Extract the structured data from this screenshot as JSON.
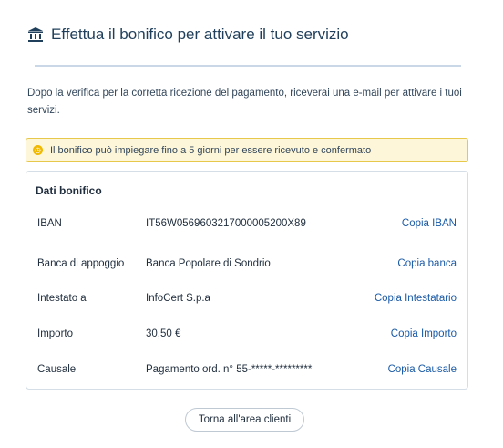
{
  "header": {
    "icon": "bank-icon",
    "title": "Effettua il bonifico per attivare il tuo servizio"
  },
  "intro_text": "Dopo la verifica per la corretta ricezione del pagamento, riceverai una e-mail per attivare i tuoi servizi.",
  "warning": {
    "icon": "warning-clock-icon",
    "text": "Il bonifico può impiegare fino a 5 giorni per essere ricevuto e confermato"
  },
  "transfer": {
    "title": "Dati bonifico",
    "rows": [
      {
        "label": "IBAN",
        "value": "IT56W0569603217000005200X89",
        "copy": "Copia IBAN"
      },
      {
        "label": "Banca di appoggio",
        "value": "Banca Popolare di Sondrio",
        "copy": "Copia banca"
      },
      {
        "label": "Intestato a",
        "value": "InfoCert S.p.a",
        "copy": "Copia Intestatario"
      },
      {
        "label": "Importo",
        "value": "30,50 €",
        "copy": "Copia Importo"
      },
      {
        "label": "Causale",
        "value": "Pagamento ord. n° 55-*****-*********",
        "copy": "Copia Causale"
      }
    ]
  },
  "back_button": "Torna all'area clienti",
  "colors": {
    "accent": "#1a5aa6",
    "title": "#1f3f5b",
    "warning_bg": "#fdf6d8",
    "warning_border": "#e8c84b"
  }
}
